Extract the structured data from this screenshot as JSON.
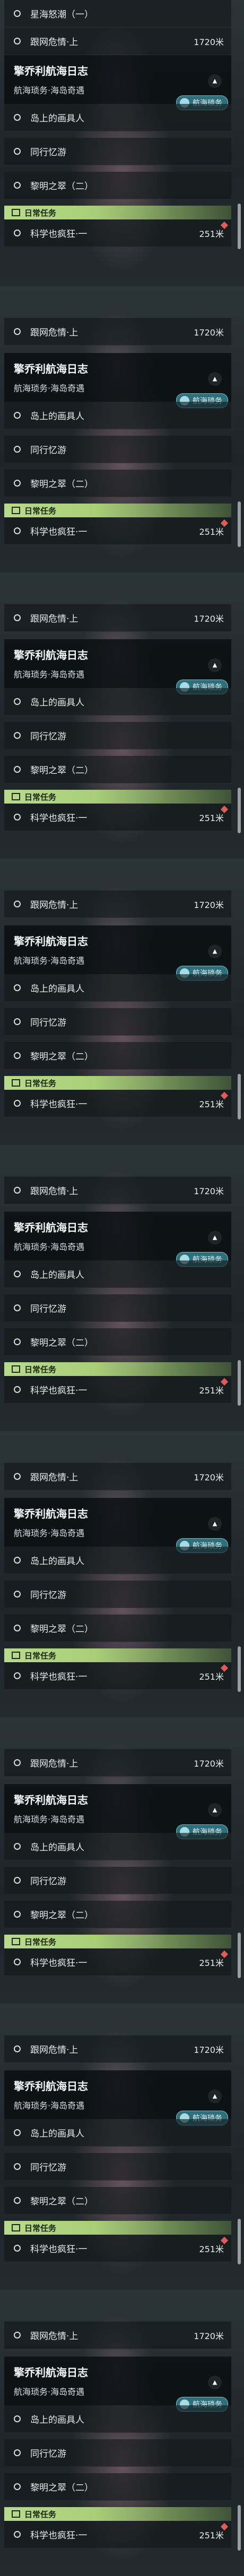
{
  "top": {
    "item0": "星海怒潮（一）",
    "item1": "跟网危情·上",
    "item1_dist": "1720米"
  },
  "group": {
    "title": "擎乔利航海日志",
    "subtitle": "航海琐务·海岛奇遇",
    "badge": "航海琐务",
    "items": [
      "岛上的画具人",
      "同行忆游",
      "黎明之翠（二）"
    ],
    "daily_label": "日常任务",
    "daily_item": "科学也疯狂·一",
    "daily_dist": "251米",
    "pre_item": "跟网危情·上",
    "pre_dist": "1720米"
  }
}
